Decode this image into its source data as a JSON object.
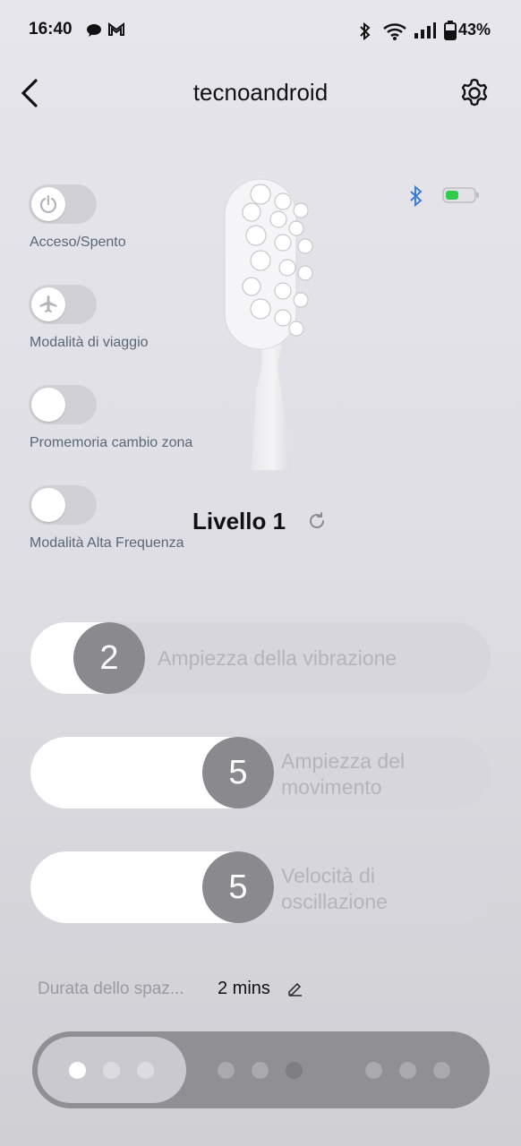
{
  "status_bar": {
    "time": "16:40",
    "battery": "43%"
  },
  "header": {
    "title": "tecnoandroid"
  },
  "toggles": [
    {
      "label": "Acceso/Spento",
      "icon": "power-icon",
      "on": false
    },
    {
      "label": "Modalità di viaggio",
      "icon": "airplane-icon",
      "on": false
    },
    {
      "label": "Promemoria cambio zona",
      "on": false
    },
    {
      "label": "Modalità Alta Frequenza",
      "on": false
    }
  ],
  "device": {
    "level": "Livello 1",
    "bluetooth_color": "#3a7be0",
    "battery_color": "#2ecc4a"
  },
  "sliders": [
    {
      "value": "2",
      "label": "Ampiezza della vibrazione"
    },
    {
      "value": "5",
      "label_line1": "Ampiezza del",
      "label_line2": "movimento"
    },
    {
      "value": "5",
      "label_line1": "Velocità di",
      "label_line2": "oscillazione"
    }
  ],
  "interval": {
    "label": "Durata dello spaz...",
    "value": "2 mins"
  },
  "colors": {
    "accent_knob": "#8a898d",
    "text_muted": "#5a6778"
  }
}
